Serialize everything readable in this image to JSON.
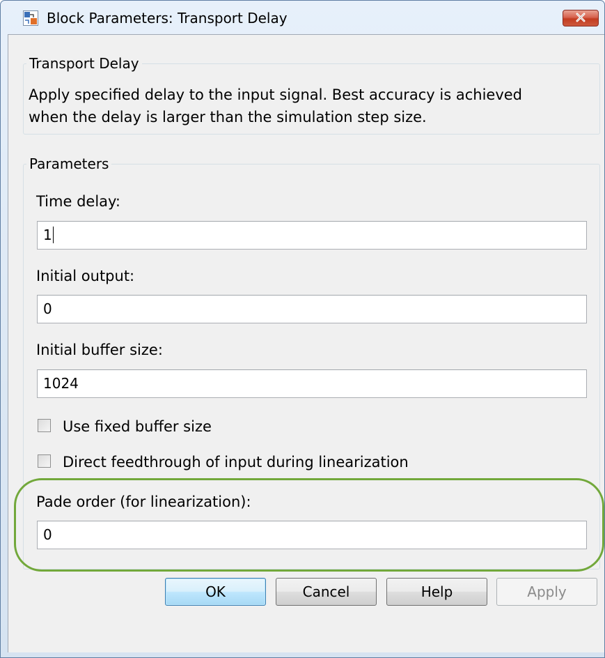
{
  "window": {
    "title": "Block Parameters: Transport Delay",
    "icon": "simulink-block-icon",
    "close_icon": "close-icon"
  },
  "description_group": {
    "title": "Transport Delay",
    "text_line1": "Apply specified delay to the input signal.  Best accuracy is achieved",
    "text_line2": "when the delay is larger than the simulation step size."
  },
  "parameters_group": {
    "title": "Parameters",
    "time_delay": {
      "label": "Time delay:",
      "value": "1"
    },
    "initial_output": {
      "label": "Initial output:",
      "value": "0"
    },
    "initial_buffer_size": {
      "label": "Initial buffer size:",
      "value": "1024"
    },
    "use_fixed_buffer": {
      "label": "Use fixed buffer size",
      "checked": false
    },
    "direct_feedthrough": {
      "label": "Direct feedthrough of input during linearization",
      "checked": false
    },
    "pade_order": {
      "label": "Pade order (for linearization):",
      "value": "0"
    }
  },
  "buttons": {
    "ok": "OK",
    "cancel": "Cancel",
    "help": "Help",
    "apply": "Apply"
  },
  "colors": {
    "highlight": "#72a83b",
    "close_button": "#c23c20",
    "default_button_border": "#3c7fb1"
  }
}
